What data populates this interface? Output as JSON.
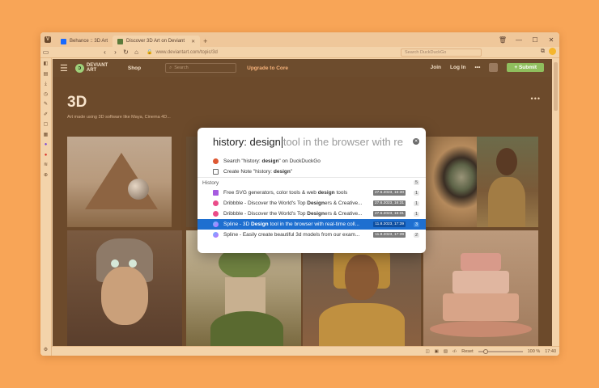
{
  "browser": {
    "tabs": [
      {
        "label": "Behance :: 3D Art",
        "favicon_color": "#1769ff",
        "active": false
      },
      {
        "label": "Discover 3D Art on Deviant",
        "favicon_color": "#5b7a3a",
        "active": true
      }
    ],
    "url": "www.deviantart.com/topic/3d",
    "search_placeholder": "Search DuckDuckGo",
    "zoom_label": "Reset",
    "zoom_value": "100 %",
    "time": "17:40"
  },
  "site": {
    "logo_text": "DEVIANT ART",
    "shop": "Shop",
    "search_placeholder": "Search",
    "upgrade": "Upgrade to Core",
    "join": "Join",
    "login": "Log In",
    "more": "•••",
    "submit": "+ Submit",
    "heading": "3D",
    "heading_more": "•••",
    "description": "Art made using 3D software like Maya, Cinema 4D..."
  },
  "popup": {
    "typed": "history: design",
    "suggestion": " tool in the browser with re",
    "actions": [
      {
        "pre": "Search \"history: ",
        "bold": "design",
        "post": "\" on DuckDuckGo",
        "icon_color": "#de5833"
      },
      {
        "pre": "Create Note \"history: ",
        "bold": "design",
        "post": "\"",
        "icon_color": "#6a6a6a"
      }
    ],
    "history_label": "History",
    "history_count": "5",
    "history": [
      {
        "pre": "Free SVG generators, color tools & web ",
        "bold": "design",
        "post": " tools",
        "date": "27.6.2023, 16:30",
        "visits": "1",
        "icon_color": "#a65be0",
        "selected": false
      },
      {
        "pre": "Dribbble - Discover the World's Top ",
        "bold": "Design",
        "post": "ers & Creative...",
        "date": "27.6.2023, 16:31",
        "visits": "1",
        "icon_color": "#ea4c89",
        "selected": false
      },
      {
        "pre": "Dribbble - Discover the World's Top ",
        "bold": "Design",
        "post": "ers & Creative...",
        "date": "27.6.2023, 16:31",
        "visits": "1",
        "icon_color": "#ea4c89",
        "selected": false
      },
      {
        "pre": "Spline - 3D ",
        "bold": "Design",
        "post": " tool in the browser with real-time coll...",
        "date": "11.8.2023, 17:39",
        "visits": "3",
        "icon_color": "#b36bff",
        "selected": true
      },
      {
        "pre": "Spline - Easily create beautiful 3d models from our exam...",
        "bold": "",
        "post": "",
        "date": "11.8.2023, 17:39",
        "visits": "2",
        "icon_color": "#b36bff",
        "selected": false
      }
    ]
  }
}
